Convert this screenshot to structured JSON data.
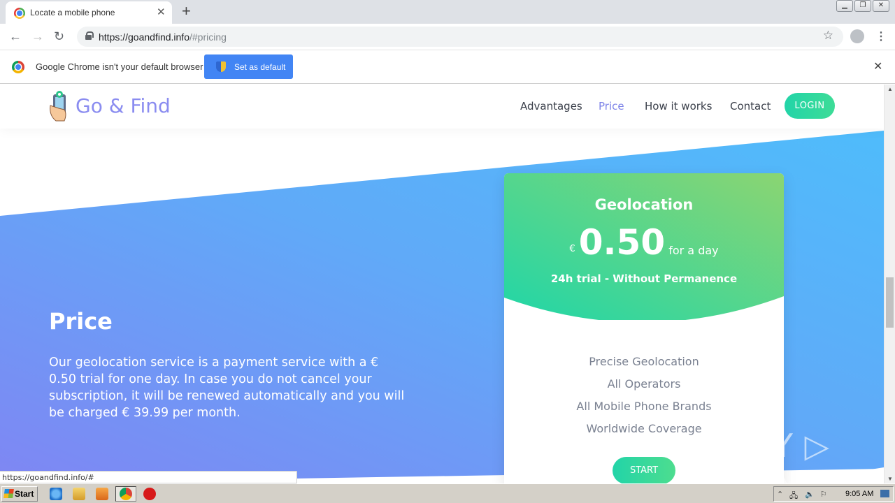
{
  "browser": {
    "tab_title": "Locate a mobile phone",
    "tab_close": "✕",
    "new_tab": "+",
    "url_host": "https://goandfind.info",
    "url_path": "/#pricing",
    "back": "←",
    "forward": "→",
    "reload": "↻",
    "bookmark": "☆",
    "menu": "⋮",
    "window_controls": [
      "▁",
      "❐",
      "✕"
    ]
  },
  "infobar": {
    "message": "Google Chrome isn't your default browser",
    "button_label": "Set as default",
    "close": "✕"
  },
  "site": {
    "logo_text": "Go & Find",
    "nav": [
      {
        "label": "Advantages",
        "active": false
      },
      {
        "label": "Price",
        "active": true
      },
      {
        "label": "How it works",
        "active": false
      },
      {
        "label": "Contact",
        "active": false
      }
    ],
    "login_label": "LOGIN"
  },
  "pricing": {
    "title": "Price",
    "description": "Our geolocation service is a payment service with a € 0.50 trial for one day. In case you do not cancel your subscription, it will be renewed automatically and you will be charged € 39.99 per month.",
    "card": {
      "title": "Geolocation",
      "currency": "€",
      "amount": "0.50",
      "period": "for a day",
      "trial": "24h trial - Without Permanence",
      "features": [
        "Precise Geolocation",
        "All Operators",
        "All Mobile Phone Brands",
        "Worldwide Coverage"
      ],
      "button_label": "START"
    }
  },
  "watermark": "ANY ▷ RUN",
  "status_url": "https://goandfind.info/#",
  "taskbar": {
    "start_label": "Start",
    "clock": "9:05 AM"
  },
  "colors": {
    "accent_green": "#22d4a8",
    "accent_purple": "#7d83e8",
    "hero_blue": "#5ab4fb",
    "chrome_blue": "#4285f4"
  }
}
